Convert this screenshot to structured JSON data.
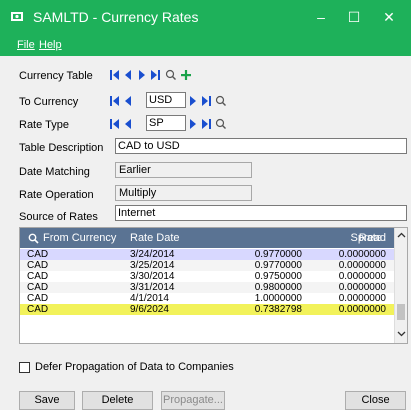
{
  "window": {
    "title": "SAMLTD - Currency Rates",
    "minimize_glyph": "–",
    "maximize_glyph": "☐",
    "close_glyph": "✕",
    "accent_color": "#1eb15a"
  },
  "menu": {
    "file": "File",
    "help": "Help"
  },
  "form": {
    "currency_table_label": "Currency Table",
    "to_currency_label": "To Currency",
    "to_currency_value": "USD",
    "rate_type_label": "Rate Type",
    "rate_type_value": "SP",
    "table_description_label": "Table Description",
    "table_description_value": "CAD to USD",
    "date_matching_label": "Date Matching",
    "date_matching_value": "Earlier",
    "rate_operation_label": "Rate Operation",
    "rate_operation_value": "Multiply",
    "source_label": "Source of Rates",
    "source_value": "Internet"
  },
  "grid": {
    "headers": {
      "from_currency": "From Currency",
      "rate_date": "Rate Date",
      "rate": "Rate",
      "spread": "Spread"
    },
    "rows": [
      {
        "from": "CAD",
        "date": "3/24/2014",
        "rate": "0.9770000",
        "spread": "0.0000000"
      },
      {
        "from": "CAD",
        "date": "3/25/2014",
        "rate": "0.9770000",
        "spread": "0.0000000"
      },
      {
        "from": "CAD",
        "date": "3/30/2014",
        "rate": "0.9750000",
        "spread": "0.0000000"
      },
      {
        "from": "CAD",
        "date": "3/31/2014",
        "rate": "0.9800000",
        "spread": "0.0000000"
      },
      {
        "from": "CAD",
        "date": "4/1/2014",
        "rate": "1.0000000",
        "spread": "0.0000000"
      },
      {
        "from": "CAD",
        "date": "9/6/2024",
        "rate": "0.7382798",
        "spread": "0.0000000"
      }
    ],
    "colors": {
      "header": "#5a7393",
      "first_row": "#d8d8ff",
      "selected_row": "#f2f25a",
      "alt_row": "#f4f4f4"
    }
  },
  "options": {
    "defer_propagation": "Defer Propagation of Data to Companies"
  },
  "buttons": {
    "save": "Save",
    "delete": "Delete",
    "propagate": "Propagate...",
    "close": "Close"
  }
}
